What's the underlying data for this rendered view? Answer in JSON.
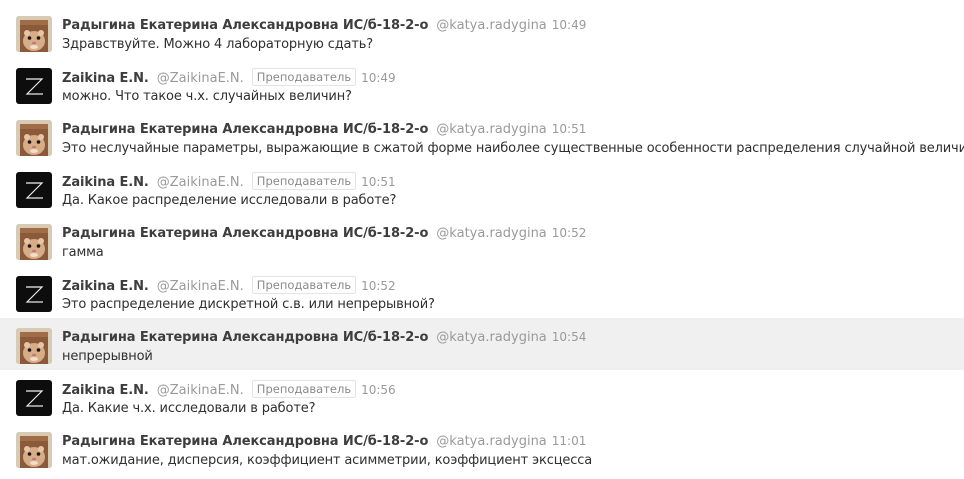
{
  "messages": [
    {
      "author": "Радыгина Екатерина Александровна ИС/б-18-2-о",
      "username": "@katya.radygina",
      "badge": "",
      "time": "10:49",
      "text": "Здравствуйте. Можно 4 лабораторную сдать?",
      "avatar": "hamster-avatar"
    },
    {
      "author": "Zaikina E.N.",
      "username": "@ZaikinaE.N.",
      "badge": "Преподаватель",
      "time": "10:49",
      "text": "можно. Что такое ч.х. случайных величин?",
      "avatar": "z-logo-avatar"
    },
    {
      "author": "Радыгина Екатерина Александровна ИС/б-18-2-о",
      "username": "@katya.radygina",
      "badge": "",
      "time": "10:51",
      "text": "Это неслучайные параметры, выражающие в сжатой форме наиболее существенные особенности распределения случайной величины",
      "avatar": "hamster-avatar"
    },
    {
      "author": "Zaikina E.N.",
      "username": "@ZaikinaE.N.",
      "badge": "Преподаватель",
      "time": "10:51",
      "text": "Да. Какое распределение исследовали в работе?",
      "avatar": "z-logo-avatar"
    },
    {
      "author": "Радыгина Екатерина Александровна ИС/б-18-2-о",
      "username": "@katya.radygina",
      "badge": "",
      "time": "10:52",
      "text": "гамма",
      "avatar": "hamster-avatar"
    },
    {
      "author": "Zaikina E.N.",
      "username": "@ZaikinaE.N.",
      "badge": "Преподаватель",
      "time": "10:52",
      "text": "Это распределение дискретной с.в. или непрерывной?",
      "avatar": "z-logo-avatar"
    },
    {
      "author": "Радыгина Екатерина Александровна ИС/б-18-2-о",
      "username": "@katya.radygina",
      "badge": "",
      "time": "10:54",
      "text": "непрерывной",
      "avatar": "hamster-avatar",
      "hovered": true
    },
    {
      "author": "Zaikina E.N.",
      "username": "@ZaikinaE.N.",
      "badge": "Преподаватель",
      "time": "10:56",
      "text": "Да. Какие ч.х. исследовали в работе?",
      "avatar": "z-logo-avatar"
    },
    {
      "author": "Радыгина Екатерина Александровна ИС/б-18-2-о",
      "username": "@katya.radygina",
      "badge": "",
      "time": "11:01",
      "text": "мат.ожидание, дисперсия, коэффициент асимметрии, коэффициент эксцесса",
      "avatar": "hamster-avatar"
    }
  ],
  "colors": {
    "hover_background": "#f0f0f0",
    "author": "#3d3d3d",
    "meta": "#9a9a9a"
  }
}
